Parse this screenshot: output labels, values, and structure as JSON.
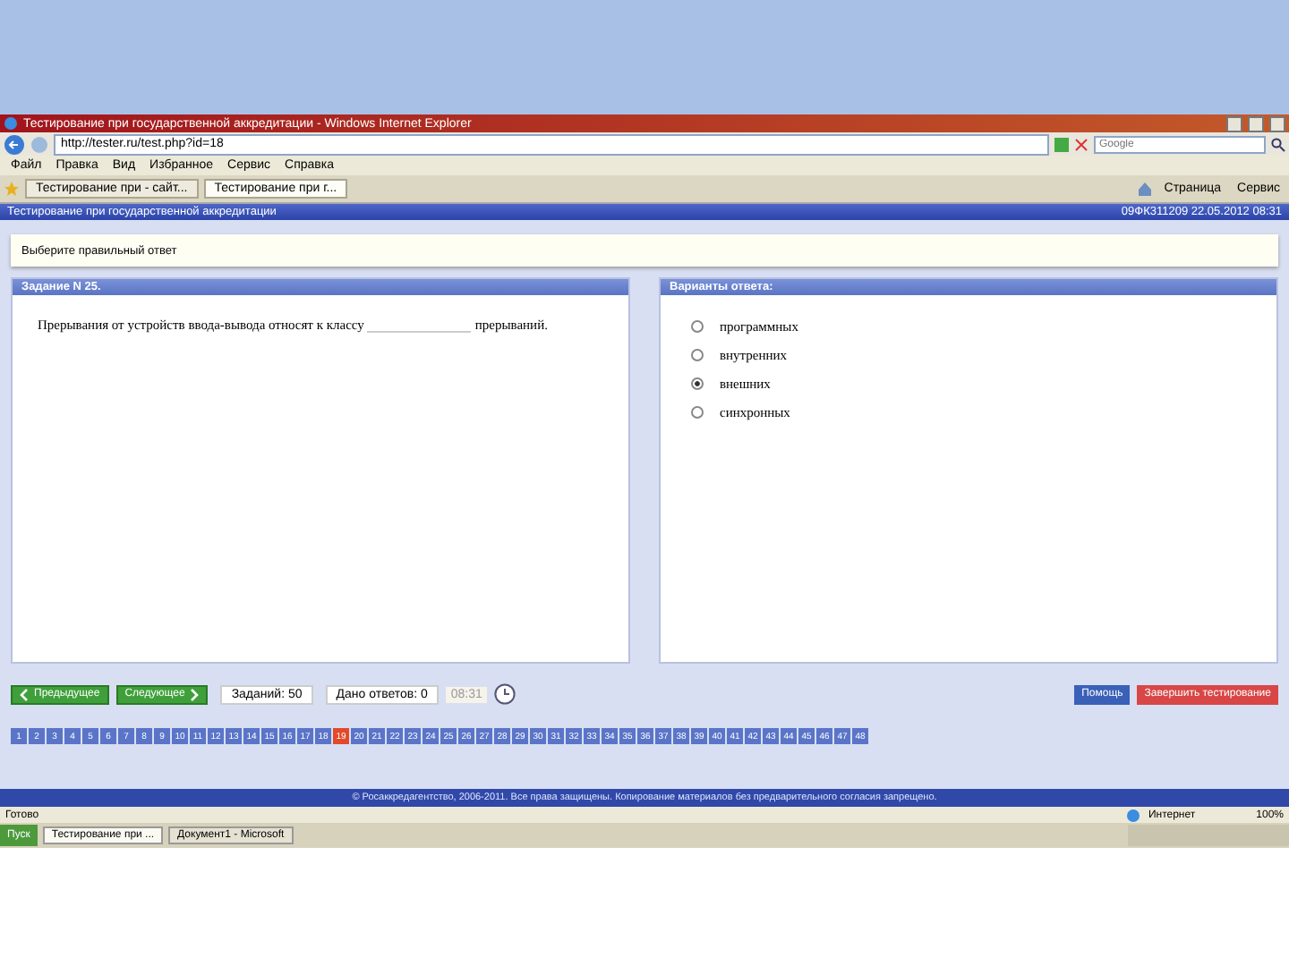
{
  "window": {
    "title": "Тестирование при государственной аккредитации - Windows Internet Explorer"
  },
  "address_bar": {
    "url": "http://tester.ru/test.php?id=18",
    "search_placeholder": "Google"
  },
  "menu": [
    "Файл",
    "Правка",
    "Вид",
    "Избранное",
    "Сервис",
    "Справка"
  ],
  "tabs": [
    {
      "label": "Тестирование при - сайт...",
      "selected": false
    },
    {
      "label": "Тестирование при г...",
      "selected": true
    }
  ],
  "command_bar": [
    "Страница",
    "Сервис"
  ],
  "page_header": {
    "title": "Тестирование при государственной аккредитации",
    "info": "09ФК311209 22.05.2012 08:31"
  },
  "instruction": "Выберите правильный ответ",
  "task": {
    "title": "Задание N 25.",
    "text_before": "Прерывания от устройств ввода-вывода относят к классу",
    "text_after": "прерываний."
  },
  "answers": {
    "title": "Варианты ответа:",
    "options": [
      {
        "label": "программных",
        "selected": false
      },
      {
        "label": "внутренних",
        "selected": false
      },
      {
        "label": "внешних",
        "selected": true
      },
      {
        "label": "синхронных",
        "selected": false
      }
    ]
  },
  "navigation": {
    "prev": "Предыдущее",
    "next": "Следующее",
    "total": "Заданий: 50",
    "answered": "Дано ответов: 0",
    "time": "08:31",
    "help": "Помощь",
    "finish": "Завершить тестирование"
  },
  "questions": [
    {
      "label": "1",
      "selected": false
    },
    {
      "label": "2",
      "selected": false
    },
    {
      "label": "3",
      "selected": false
    },
    {
      "label": "4",
      "selected": false
    },
    {
      "label": "5",
      "selected": false
    },
    {
      "label": "6",
      "selected": false
    },
    {
      "label": "7",
      "selected": false
    },
    {
      "label": "8",
      "selected": false
    },
    {
      "label": "9",
      "selected": false
    },
    {
      "label": "10",
      "selected": false
    },
    {
      "label": "11",
      "selected": false
    },
    {
      "label": "12",
      "selected": false
    },
    {
      "label": "13",
      "selected": false
    },
    {
      "label": "14",
      "selected": false
    },
    {
      "label": "15",
      "selected": false
    },
    {
      "label": "16",
      "selected": false
    },
    {
      "label": "17",
      "selected": false
    },
    {
      "label": "18",
      "selected": false
    },
    {
      "label": "19",
      "selected": true
    },
    {
      "label": "20",
      "selected": false
    },
    {
      "label": "21",
      "selected": false
    },
    {
      "label": "22",
      "selected": false
    },
    {
      "label": "23",
      "selected": false
    },
    {
      "label": "24",
      "selected": false
    },
    {
      "label": "25",
      "selected": false
    },
    {
      "label": "26",
      "selected": false
    },
    {
      "label": "27",
      "selected": false
    },
    {
      "label": "28",
      "selected": false
    },
    {
      "label": "29",
      "selected": false
    },
    {
      "label": "30",
      "selected": false
    },
    {
      "label": "31",
      "selected": false
    },
    {
      "label": "32",
      "selected": false
    },
    {
      "label": "33",
      "selected": false
    },
    {
      "label": "34",
      "selected": false
    },
    {
      "label": "35",
      "selected": false
    },
    {
      "label": "36",
      "selected": false
    },
    {
      "label": "37",
      "selected": false
    },
    {
      "label": "38",
      "selected": false
    },
    {
      "label": "39",
      "selected": false
    },
    {
      "label": "40",
      "selected": false
    },
    {
      "label": "41",
      "selected": false
    },
    {
      "label": "42",
      "selected": false
    },
    {
      "label": "43",
      "selected": false
    },
    {
      "label": "44",
      "selected": false
    },
    {
      "label": "45",
      "selected": false
    },
    {
      "label": "46",
      "selected": false
    },
    {
      "label": "47",
      "selected": false
    },
    {
      "label": "48",
      "selected": false
    }
  ],
  "footer": "© Росаккредагентство, 2006-2011. Все права защищены. Копирование материалов без предварительного согласия запрещено.",
  "status_bar": {
    "text": "Готово",
    "zone": "Интернет",
    "zoom": "100%"
  },
  "taskbar": {
    "start": "Пуск",
    "items": [
      {
        "label": "Тестирование при ...",
        "selected": true
      },
      {
        "label": "Документ1 - Microsoft",
        "selected": false
      }
    ]
  }
}
